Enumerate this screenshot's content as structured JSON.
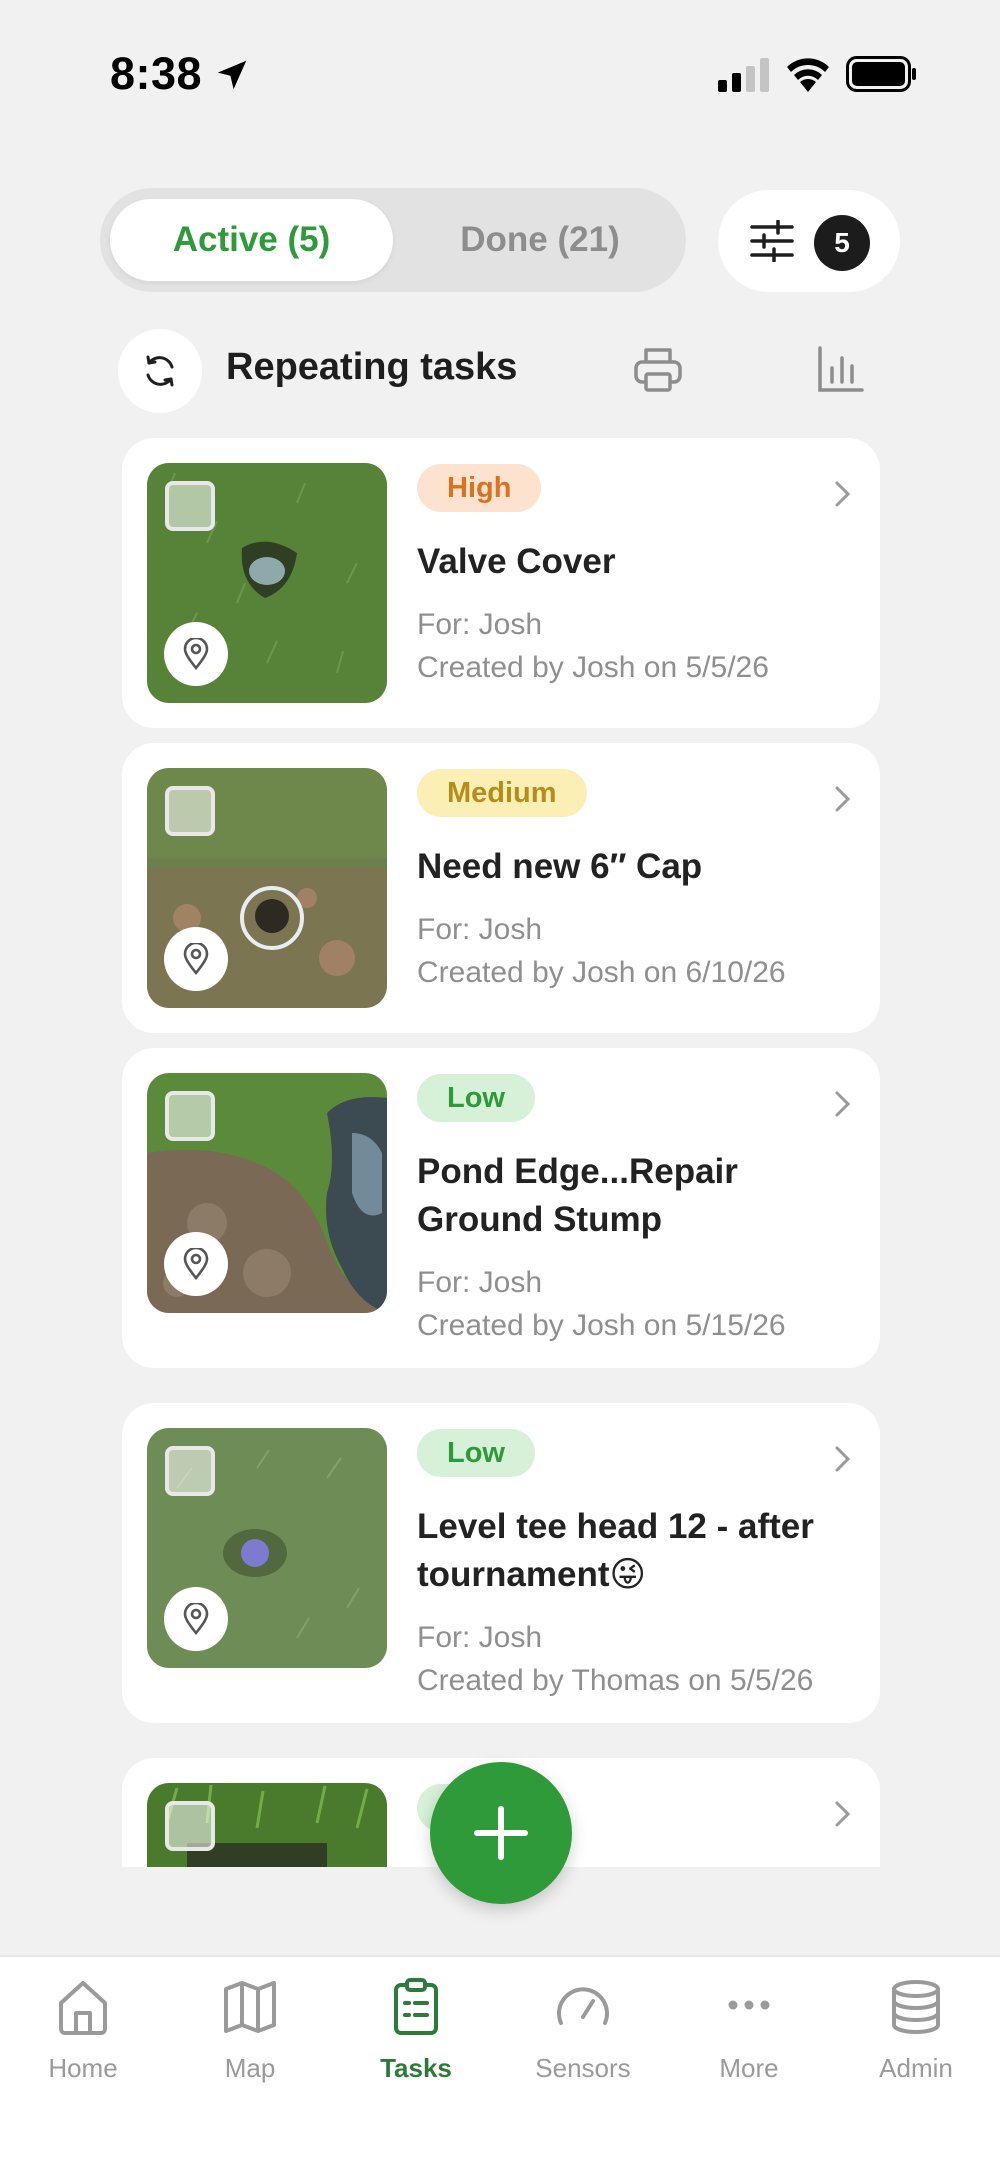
{
  "status_bar": {
    "time": "8:38",
    "icons": [
      "location-arrow-icon",
      "cellular-signal-icon",
      "wifi-icon",
      "battery-icon"
    ]
  },
  "segments": {
    "active_label": "Active (5)",
    "done_label": "Done (21)"
  },
  "filter": {
    "icon": "sliders-icon",
    "count": "5"
  },
  "toolbar": {
    "repeat_icon": "refresh-icon",
    "repeating_label": "Repeating tasks",
    "print_icon": "printer-icon",
    "stats_icon": "bar-chart-icon"
  },
  "tasks": [
    {
      "priority": "High",
      "title": "Valve Cover",
      "for": "For: Josh",
      "created": "Created by Josh on 5/5/26"
    },
    {
      "priority": "Medium",
      "title": "Need new 6″ Cap",
      "for": "For: Josh",
      "created": "Created by Josh on 6/10/26"
    },
    {
      "priority": "Low",
      "title": "Pond Edge...Repair Ground Stump",
      "for": "For: Josh",
      "created": "Created by Josh on 5/15/26"
    },
    {
      "priority": "Low",
      "title": "Level tee head 12 - after tournament😜",
      "for": "For: Josh",
      "created": "Created by Thomas on 5/5/26"
    },
    {
      "priority": "Low",
      "title": "",
      "for": "",
      "created": ""
    }
  ],
  "fab": {
    "icon": "plus-icon"
  },
  "tabbar": {
    "items": [
      {
        "label": "Home",
        "icon": "home-icon"
      },
      {
        "label": "Map",
        "icon": "map-icon"
      },
      {
        "label": "Tasks",
        "icon": "clipboard-icon"
      },
      {
        "label": "Sensors",
        "icon": "gauge-icon"
      },
      {
        "label": "More",
        "icon": "more-dots-icon"
      },
      {
        "label": "Admin",
        "icon": "database-icon"
      }
    ],
    "active": "Tasks"
  },
  "colors": {
    "accent": "#2e9a3a",
    "high": "#d8741f",
    "medium": "#b38e1a",
    "low": "#2e9a3a"
  }
}
